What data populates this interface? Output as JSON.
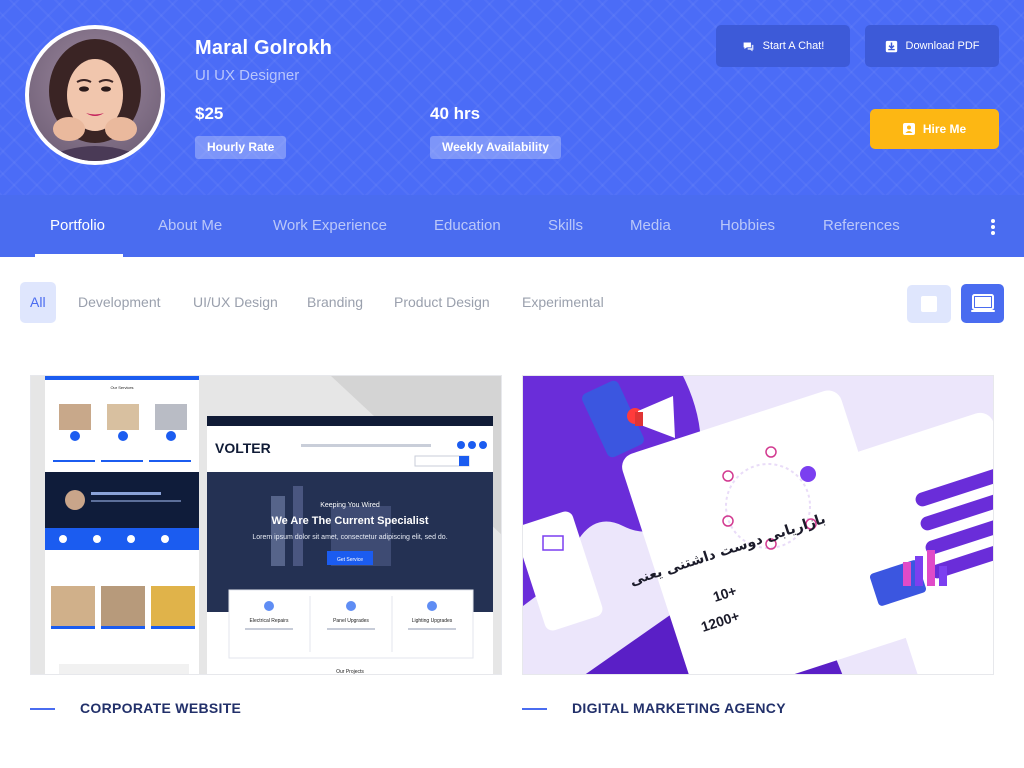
{
  "profile": {
    "name": "Maral Golrokh",
    "role": "UI UX Designer",
    "hourly_rate_value": "$25",
    "hourly_rate_label": "Hourly Rate",
    "availability_value": "40 hrs",
    "availability_label": "Weekly Availability"
  },
  "actions": {
    "chat": "Start A Chat!",
    "pdf": "Download PDF",
    "hire": "Hire Me"
  },
  "nav": {
    "items": [
      "Portfolio",
      "About Me",
      "Work Experience",
      "Education",
      "Skills",
      "Media",
      "Hobbies",
      "References"
    ],
    "active": "Portfolio"
  },
  "filters": {
    "items": [
      "All",
      "Development",
      "UI/UX Design",
      "Branding",
      "Product Design",
      "Experimental"
    ],
    "active": "All"
  },
  "projects": [
    {
      "title": "CORPORATE WEBSITE",
      "thumb": {
        "brand": "VOLTER",
        "hero_small": "Keeping You Wired",
        "hero_title": "We Are The Current Specialist",
        "hero_sub": "Lorem ipsum dolor sit amet, consectetur adipiscing elit, sed do.",
        "cta": "Get Service",
        "services": [
          "Electrical Repairs",
          "Panel Upgrades",
          "Lighting Upgrades"
        ],
        "projects_heading": "Our Projects",
        "left_heading": "Our Services"
      }
    },
    {
      "title": "DIGITAL MARKETING AGENCY",
      "thumb": {
        "headline": "بازاریابی دوست داشتنی یعنی",
        "stat1": "10+",
        "stat2": "1200+"
      }
    }
  ],
  "colors": {
    "hero": "#4b6cf7",
    "nav": "#4a6cf0",
    "accent_yellow": "#fdb713",
    "title_navy": "#22306a"
  }
}
